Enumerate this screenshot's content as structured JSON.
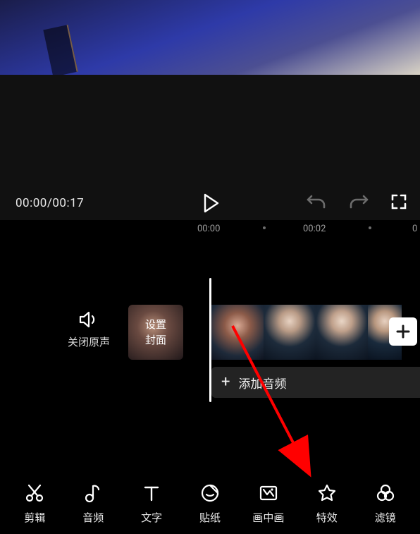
{
  "playback": {
    "time": "00:00/00:17",
    "ruler": [
      "00:00",
      "00:02",
      "0"
    ]
  },
  "controls": {
    "mute_label": "关闭原声",
    "cover_line1": "设置",
    "cover_line2": "封面",
    "add_audio": "添加音频"
  },
  "toolbar": [
    {
      "key": "cut",
      "label": "剪辑"
    },
    {
      "key": "audio",
      "label": "音频"
    },
    {
      "key": "text",
      "label": "文字"
    },
    {
      "key": "sticker",
      "label": "贴纸"
    },
    {
      "key": "pip",
      "label": "画中画"
    },
    {
      "key": "effect",
      "label": "特效"
    },
    {
      "key": "filter",
      "label": "滤镜"
    }
  ],
  "colors": {
    "accent_arrow": "#ff0000"
  }
}
